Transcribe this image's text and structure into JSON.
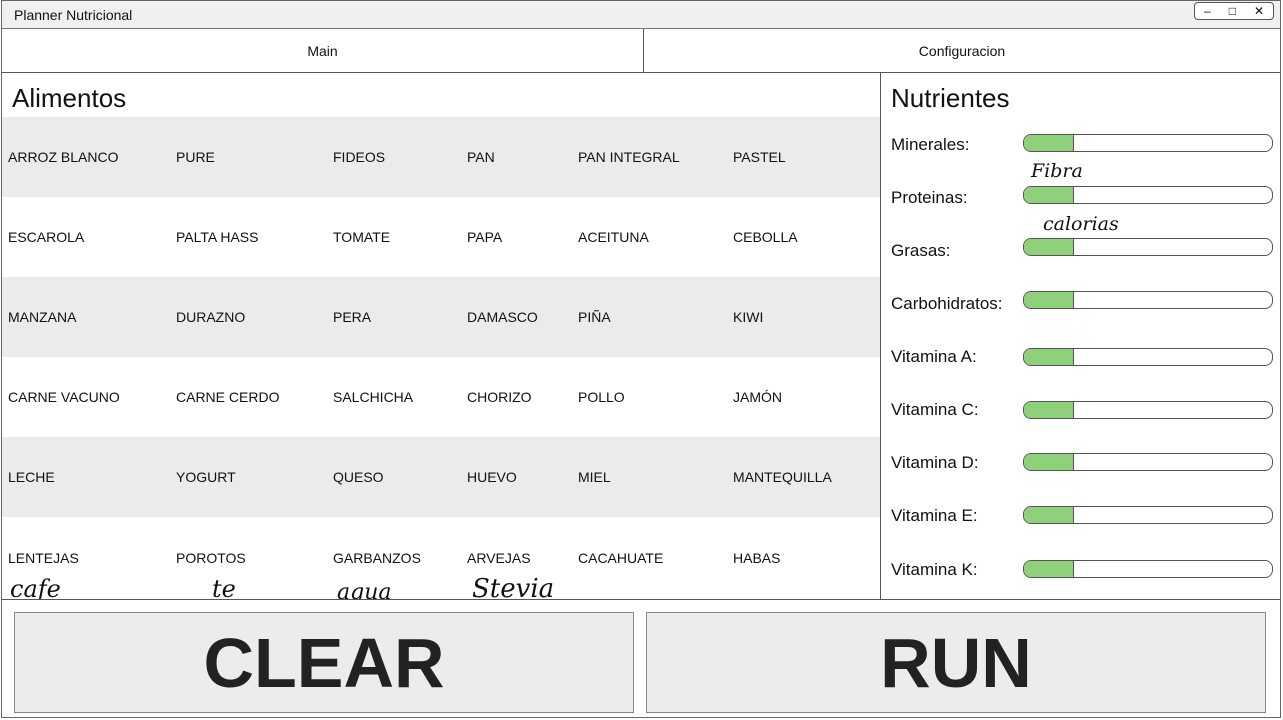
{
  "window": {
    "title": "Planner Nutricional",
    "controls": [
      "–",
      "□",
      "✕"
    ]
  },
  "tabs": [
    {
      "label": "Main"
    },
    {
      "label": "Configuracion"
    }
  ],
  "foods": {
    "heading": "Alimentos",
    "rows": [
      [
        "ARROZ BLANCO",
        "PURE",
        "FIDEOS",
        "PAN",
        "PAN INTEGRAL",
        "PASTEL"
      ],
      [
        "ESCAROLA",
        "PALTA HASS",
        "TOMATE",
        "PAPA",
        "ACEITUNA",
        "CEBOLLA"
      ],
      [
        "MANZANA",
        "DURAZNO",
        "PERA",
        "DAMASCO",
        "PIÑA",
        "KIWI"
      ],
      [
        "CARNE VACUNO",
        "CARNE CERDO",
        "SALCHICHA",
        "CHORIZO",
        "POLLO",
        "JAMÓN"
      ],
      [
        "LECHE",
        "YOGURT",
        "QUESO",
        "HUEVO",
        "MIEL",
        "MANTEQUILLA"
      ],
      [
        "LENTEJAS",
        "POROTOS",
        "GARBANZOS",
        "ARVEJAS",
        "CACAHUATE",
        "HABAS"
      ]
    ],
    "handwritten_extra": [
      "cafe",
      "te",
      "agua",
      "Stevia"
    ]
  },
  "nutrients": {
    "heading": "Nutrientes",
    "items": [
      {
        "label": "Minerales:",
        "level": 0.2
      },
      {
        "label": "Proteinas:",
        "level": 0.2
      },
      {
        "label": "Grasas:",
        "level": 0.2
      },
      {
        "label": "Carbohidratos:",
        "level": 0.2
      },
      {
        "label": "Vitamina A:",
        "level": 0.2
      },
      {
        "label": "Vitamina C:",
        "level": 0.2
      },
      {
        "label": "Vitamina D:",
        "level": 0.2
      },
      {
        "label": "Vitamina E:",
        "level": 0.2
      },
      {
        "label": "Vitamina K:",
        "level": 0.2
      }
    ],
    "handwritten_notes": [
      "Fibra",
      "calorias"
    ],
    "fill_color": "#8fd07a"
  },
  "actions": {
    "clear_label": "CLEAR",
    "run_label": "RUN"
  }
}
